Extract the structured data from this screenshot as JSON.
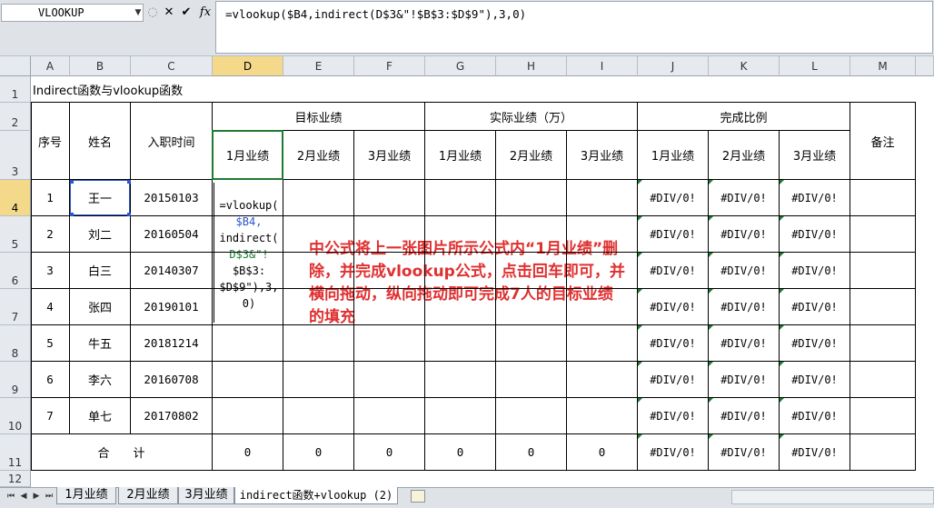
{
  "formula_bar": {
    "name_box": "VLOOKUP",
    "cancel_symbol": "✕",
    "enter_symbol": "✔",
    "fx_symbol": "fx",
    "formula": "=vlookup($B4,indirect(D$3&\"!$B$3:$D$9\"),3,0)"
  },
  "columns": [
    "A",
    "B",
    "C",
    "D",
    "E",
    "F",
    "G",
    "H",
    "I",
    "J",
    "K",
    "L",
    "M"
  ],
  "rows": [
    "1",
    "2",
    "3",
    "4",
    "5",
    "6",
    "7",
    "8",
    "9",
    "10",
    "11",
    "12"
  ],
  "sheet": {
    "title": "Indirect函数与vlookup函数",
    "headers": {
      "seq": "序号",
      "name": "姓名",
      "hire_date": "入职时间",
      "target": "目标业绩",
      "actual": "实际业绩（万）",
      "ratio": "完成比例",
      "remark": "备注",
      "months": [
        "1月业绩",
        "2月业绩",
        "3月业绩"
      ]
    },
    "records": [
      {
        "seq": "1",
        "name": "王一",
        "date": "20150103"
      },
      {
        "seq": "2",
        "name": "刘二",
        "date": "20160504"
      },
      {
        "seq": "3",
        "name": "白三",
        "date": "20140307"
      },
      {
        "seq": "4",
        "name": "张四",
        "date": "20190101"
      },
      {
        "seq": "5",
        "name": "牛五",
        "date": "20181214"
      },
      {
        "seq": "6",
        "name": "李六",
        "date": "20160708"
      },
      {
        "seq": "7",
        "name": "单七",
        "date": "20170802"
      }
    ],
    "error_value": "#DIV/0!",
    "total_label": "合　　计",
    "totals": [
      "0",
      "0",
      "0",
      "0",
      "0",
      "0"
    ],
    "editing_lines": [
      "=vlookup(",
      "$B4,",
      "indirect(",
      "D$3&\"!",
      "$B$3:",
      "$D$9\"),3,",
      "0)"
    ]
  },
  "note": "中公式将上一张图片所示公式内“1月业绩”删除，并完成vlookup公式，点击回车即可，并横向拖动，纵向拖动即可完成7人的目标业绩的填充",
  "tabs": [
    {
      "label": "1月业绩",
      "active": false
    },
    {
      "label": "2月业绩",
      "active": false
    },
    {
      "label": "3月业绩",
      "active": false
    },
    {
      "label": "indirect函数+vlookup (2)",
      "active": true
    }
  ],
  "colors": {
    "accent": "#f5d98a",
    "error_flag": "#1e7b32",
    "note": "#e03030",
    "selection": "#2a55d0"
  }
}
